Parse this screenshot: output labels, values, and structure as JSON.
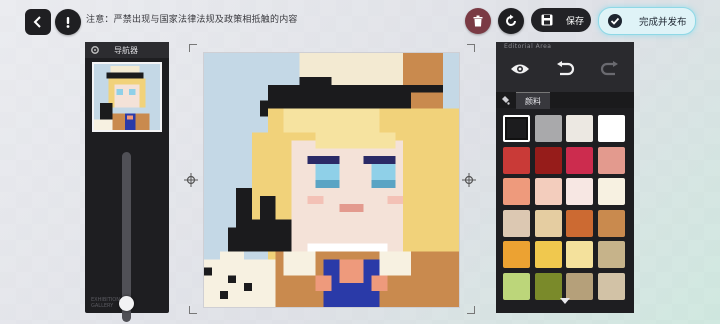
{
  "toolbar": {
    "back_icon": "chevron-left-icon",
    "alert_icon": "exclamation-icon",
    "notice": "注意：严禁出现与国家法律法规及政策相抵触的内容",
    "trash_icon": "trash-icon",
    "refresh_icon": "refresh-icon",
    "save_icon": "floppy-icon",
    "save_label": "保存",
    "publish_icon": "check-circle-icon",
    "publish_label": "完成并发布"
  },
  "navigator": {
    "title": "导航器",
    "zoom_level": 0.93,
    "watermark_line1": "EXHIBITION",
    "watermark_line2": "GALLERY"
  },
  "editor": {
    "area_label": "Editorial Area",
    "tools": [
      "eye-icon",
      "undo-icon",
      "redo-icon"
    ],
    "palette_tab": "颜料",
    "palette_icon": "paint-bucket-icon",
    "selected_color": "#1c1c1e",
    "colors": [
      "#1c1c1e",
      "#a9a9ab",
      "#ece8e2",
      "#ffffff",
      "#c93a37",
      "#961c1a",
      "#cc2c4e",
      "#e39a8e",
      "#ee9a7c",
      "#f3cdbd",
      "#f7e7e3",
      "#f7f1e1",
      "#dcc8b2",
      "#e5cda1",
      "#cc6a32",
      "#c98a4e",
      "#eca232",
      "#f0c84e",
      "#f4e19c",
      "#c6b38a",
      "#bcd67a",
      "#7a8a2a",
      "#b5a07a",
      "#d2c2a6"
    ]
  }
}
